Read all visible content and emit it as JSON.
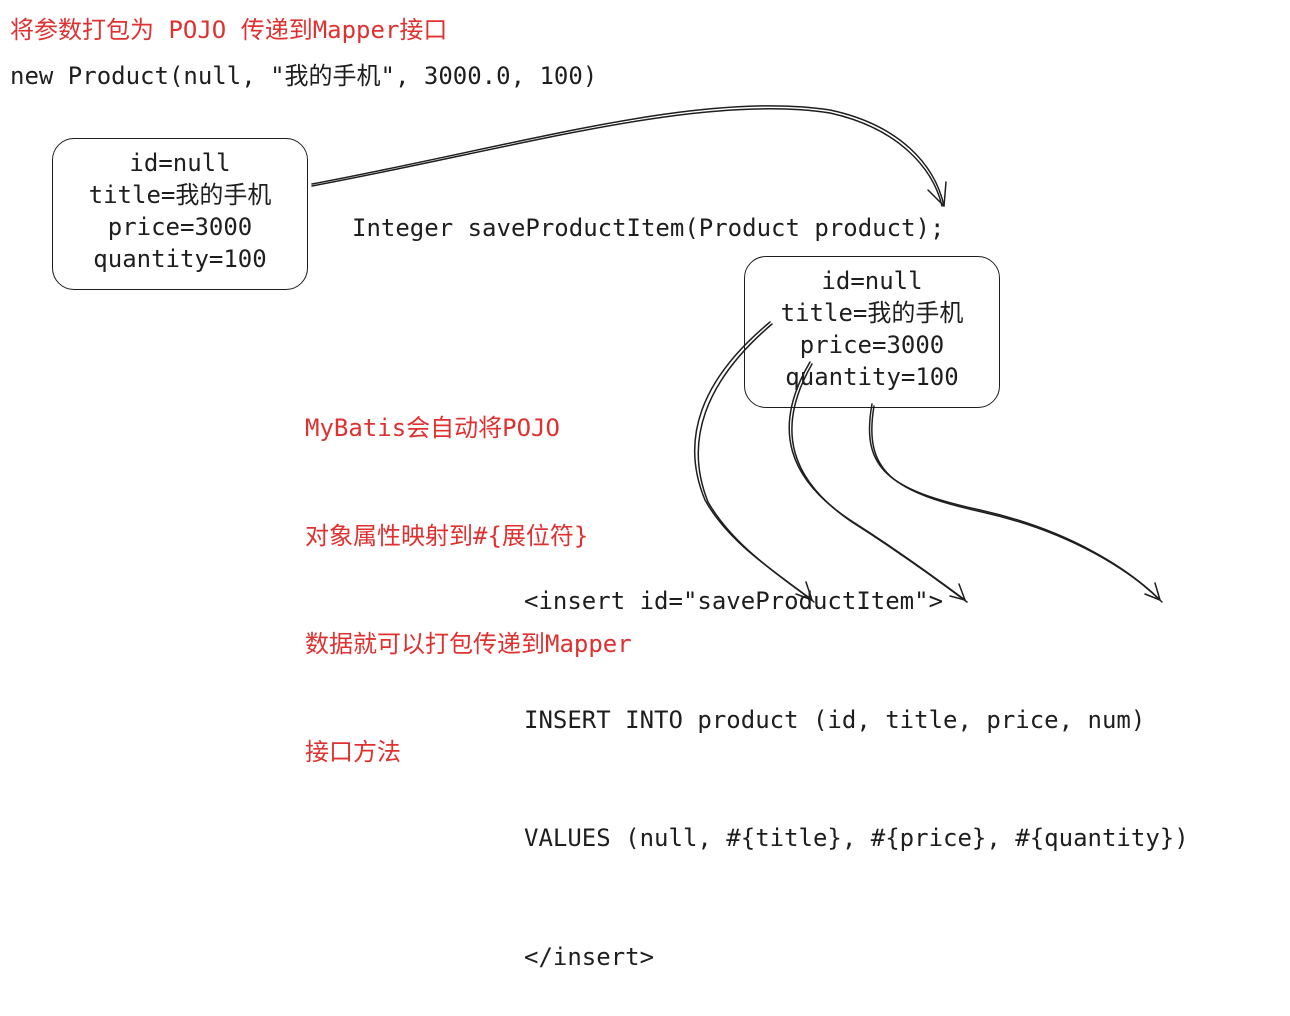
{
  "heading": "将参数打包为 POJO 传递到Mapper接口",
  "constructor_call": "new Product(null, \"我的手机\", 3000.0, 100)",
  "method_signature": "Integer saveProductItem(Product product);",
  "pojo_box_left": {
    "lines": [
      "id=null",
      "title=我的手机",
      "price=3000",
      "quantity=100"
    ]
  },
  "pojo_box_right": {
    "lines": [
      "id=null",
      "title=我的手机",
      "price=3000",
      "quantity=100"
    ]
  },
  "note": {
    "lines": [
      "MyBatis会自动将POJO",
      "对象属性映射到#{展位符}",
      "数据就可以打包传递到Mapper",
      "接口方法"
    ]
  },
  "sql": {
    "lines": [
      "<insert id=\"saveProductItem\">",
      "INSERT INTO product (id, title, price, num)",
      "VALUES (null, #{title}, #{price}, #{quantity})",
      "</insert>"
    ]
  },
  "colors": {
    "annotation": "#e03131",
    "ink": "#1e1e1e"
  }
}
